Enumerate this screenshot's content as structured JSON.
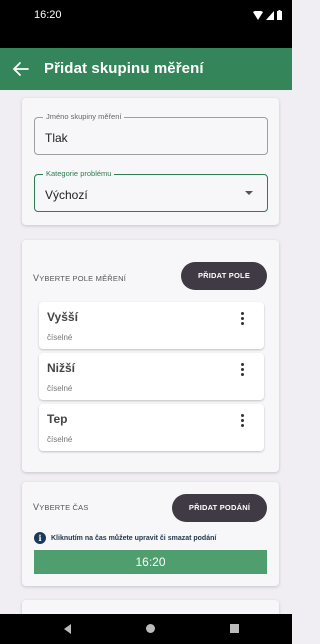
{
  "status_bar": {
    "time": "16:20",
    "icons": [
      "wifi-icon",
      "signal-icon",
      "battery-icon"
    ]
  },
  "app_bar": {
    "title": "Přidat skupinu měření",
    "back_icon": "arrow-left-icon",
    "color": "#34855a"
  },
  "group_form": {
    "name_field": {
      "label": "Jméno skupiny měření",
      "value": "Tlak"
    },
    "category_field": {
      "label": "Kategorie problému",
      "value": "Výchozí"
    }
  },
  "fields_section": {
    "label": "Vyberte pole měření",
    "add_button": "PŘIDAT POLE",
    "items": [
      {
        "name": "Vyšší",
        "type": "číselné"
      },
      {
        "name": "Nižší",
        "type": "číselné"
      },
      {
        "name": "Tep",
        "type": "číselné"
      }
    ]
  },
  "time_section": {
    "label": "Vyberte čas",
    "add_button": "PŘIDAT PODÁNÍ",
    "info_text": "Kliknutím na čas můžete upravit či smazat podání",
    "time_value": "16:20"
  },
  "colors": {
    "primary": "#34855a",
    "time_bar": "#4e9e6e",
    "button": "#3f3a43"
  }
}
